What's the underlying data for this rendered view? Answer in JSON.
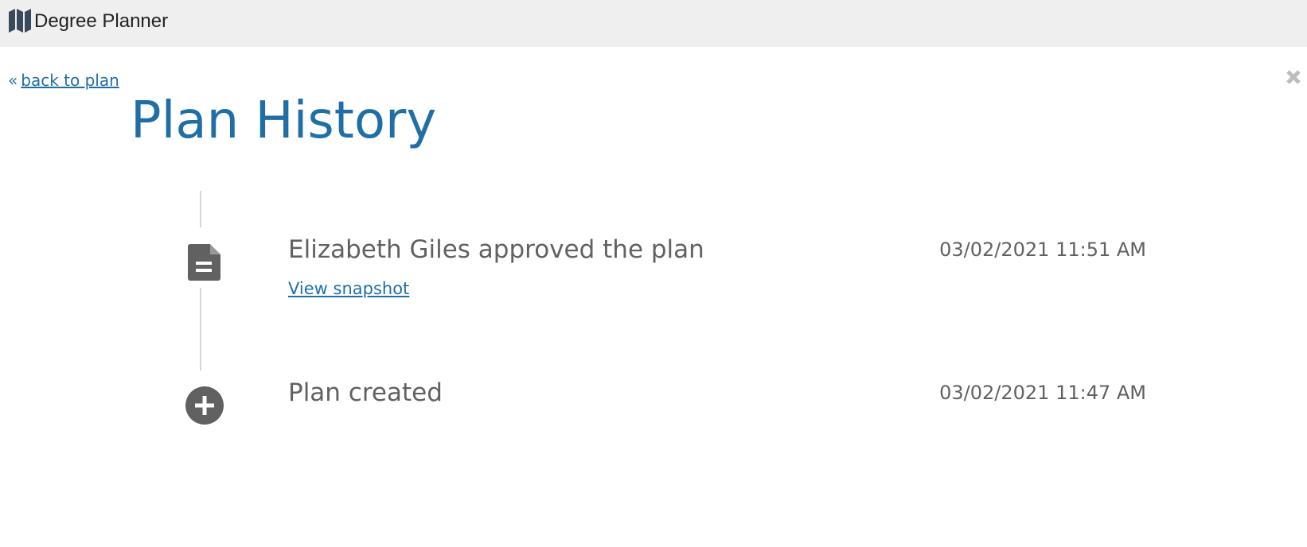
{
  "app": {
    "title": "Degree Planner",
    "icon": "map-icon"
  },
  "nav": {
    "back_label": "back to plan",
    "back_icon": "double-chevron-left-icon",
    "close_icon": "close-icon"
  },
  "page": {
    "title": "Plan History"
  },
  "colors": {
    "accent": "#1f6fa6",
    "text_muted": "#616161",
    "icon": "#616161",
    "topbar_bg": "#efefef",
    "timeline": "#d6d6d6"
  },
  "events": [
    {
      "title": "Elizabeth Giles approved the plan",
      "timestamp": "03/02/2021 11:51 AM",
      "link_label": "View snapshot",
      "icon": "document-icon"
    },
    {
      "title": "Plan created",
      "timestamp": "03/02/2021 11:47 AM",
      "icon": "plus-circle-icon"
    }
  ]
}
